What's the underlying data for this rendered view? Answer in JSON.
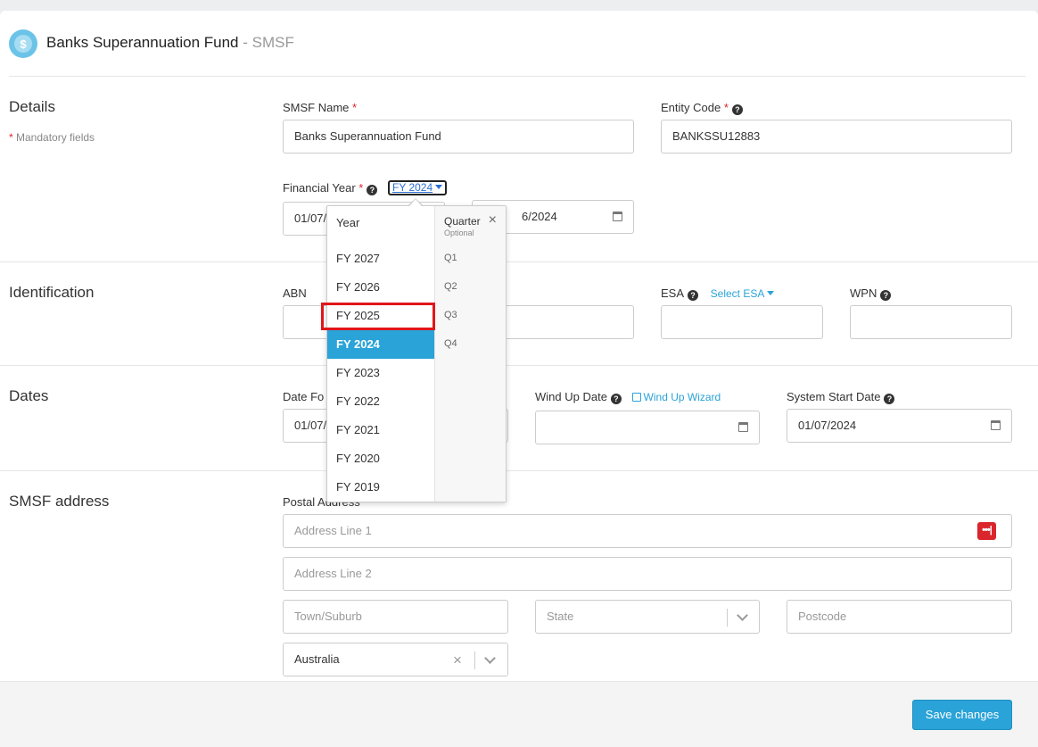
{
  "header": {
    "title": "Banks Superannuation Fund",
    "subtitle": "- SMSF"
  },
  "details": {
    "section_title": "Details",
    "mandatory_note": "Mandatory fields",
    "smsf_name_label": "SMSF Name",
    "smsf_name_value": "Banks Superannuation Fund",
    "entity_code_label": "Entity Code",
    "entity_code_value": "BANKSSU12883",
    "financial_year_label": "Financial Year",
    "financial_year_selected": "FY 2024",
    "fy_start_visible": "01/07/",
    "fy_end_visible": "6/2024"
  },
  "dropdown": {
    "year_header": "Year",
    "quarter_header": "Quarter",
    "quarter_sub": "Optional",
    "close": "×",
    "years": [
      "FY 2027",
      "FY 2026",
      "FY 2025",
      "FY 2024",
      "FY 2023",
      "FY 2022",
      "FY 2021",
      "FY 2020",
      "FY 2019"
    ],
    "selected_year": "FY 2024",
    "highlighted_year": "FY 2025",
    "quarters": [
      "Q1",
      "Q2",
      "Q3",
      "Q4"
    ]
  },
  "identification": {
    "section_title": "Identification",
    "abn_label": "ABN",
    "esa_label": "ESA",
    "select_esa": "Select ESA",
    "wpn_label": "WPN"
  },
  "dates": {
    "section_title": "Dates",
    "date_formed_label": "Date Fo",
    "date_formed_visible": "01/07/",
    "wind_up_label": "Wind Up Date",
    "wind_up_wizard": "Wind Up Wizard",
    "system_start_label": "System Start Date",
    "system_start_value": "01/07/2024"
  },
  "address": {
    "section_title": "SMSF address",
    "postal_label": "Postal Address",
    "line1_placeholder": "Address Line 1",
    "line2_placeholder": "Address Line 2",
    "town_placeholder": "Town/Suburb",
    "state_placeholder": "State",
    "postcode_placeholder": "Postcode",
    "country_value": "Australia"
  },
  "footer": {
    "save_label": "Save changes"
  },
  "colors": {
    "accent": "#2aa3d8",
    "required": "#d9262c",
    "highlight": "#e0161b"
  },
  "icons": [
    "logo-icon",
    "help-icon",
    "calendar-icon",
    "external-link-icon",
    "password-manager-icon",
    "chevron-down-icon",
    "close-icon"
  ]
}
